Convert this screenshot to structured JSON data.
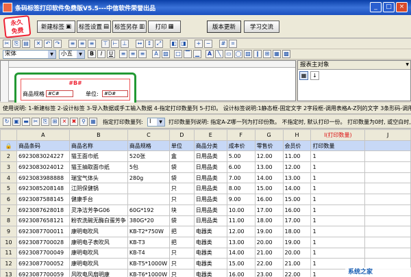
{
  "window": {
    "title": "条码标签打印软件免费版V5.5---中信软件荣誉出品"
  },
  "logo": {
    "line1": "永久",
    "line2": "免费"
  },
  "top_buttons": [
    {
      "label": "新建标签",
      "icon": "new-icon"
    },
    {
      "label": "标签设置",
      "icon": "settings-icon"
    },
    {
      "label": "标签另存",
      "icon": "saveas-icon"
    },
    {
      "label": "打印",
      "icon": "print-icon"
    },
    {
      "label": "版本更新",
      "icon": "update-icon"
    },
    {
      "label": "学习交流",
      "icon": "chat-icon"
    }
  ],
  "font_bar": {
    "font": "宋体",
    "size": "小五",
    "bold": "B",
    "italic": "I",
    "underline": "U"
  },
  "label_preview": {
    "barcode_field": "#B#",
    "field1_label": "商品规格",
    "field1_value": "#C#",
    "field2_label": "单位:",
    "field2_value": "#D#"
  },
  "props_panel": {
    "title": "报表主对象"
  },
  "instructions": "使用说明: 1-新建标签 2-设计标签 3-导入数据或手工输入数据 4-指定打印数量列 5-打印。 设计标签说明:1静态框-固定文字 2字段框-调用表格A-Z列的文字 3条形码-调用表格A-Z列的",
  "data_toolbar": {
    "print_qty_label": "指定打印数量列:",
    "print_qty_value": "I",
    "hint": "打印数量列说明: 指定A-Z哪一列为打印份数。 不指定时, 默认打印一份。 打印数量为0时, 或空白时, 不打印"
  },
  "grid": {
    "columns": [
      "A",
      "B",
      "C",
      "D",
      "E",
      "F",
      "G",
      "H",
      "I(打印数量)",
      "J"
    ],
    "header_row": [
      "商品条码",
      "商品名称",
      "商品规格",
      "单位",
      "商品分类",
      "成本价",
      "零售价",
      "会员价",
      "打印数量",
      ""
    ],
    "rows": [
      [
        "2",
        "6923083024227",
        "猫王面巾纸",
        "520张",
        "盒",
        "日用品类",
        "5.00",
        "12.00",
        "11.00",
        "1",
        ""
      ],
      [
        "3",
        "6923083024012",
        "猫王抽取面巾纸",
        "5包",
        "袋",
        "日用品类",
        "6.00",
        "13.00",
        "12.00",
        "1",
        ""
      ],
      [
        "4",
        "6923083988888",
        "瑞宝气体头",
        "280g",
        "袋",
        "日用品类",
        "7.00",
        "14.00",
        "13.00",
        "1",
        ""
      ],
      [
        "5",
        "6923085208148",
        "江阴保健锅",
        "",
        "只",
        "日用品类",
        "8.00",
        "15.00",
        "14.00",
        "1",
        ""
      ],
      [
        "6",
        "6923087588145",
        "健康手台",
        "",
        "只",
        "日用品类",
        "9.00",
        "16.00",
        "15.00",
        "1",
        ""
      ],
      [
        "7",
        "6923087628018",
        "灵净洁芳争G06",
        "60G*192",
        "块",
        "日用品类",
        "10.00",
        "17.00",
        "16.00",
        "1",
        ""
      ],
      [
        "8",
        "6923087658121",
        "粉农洗碗无酶白蛋芳争",
        "380G*20",
        "袋",
        "日用品类",
        "11.00",
        "18.00",
        "17.00",
        "1",
        ""
      ],
      [
        "9",
        "6923087700011",
        "康明电吹风",
        "KB-T2*750W",
        "把",
        "电器类",
        "12.00",
        "19.00",
        "18.00",
        "1",
        ""
      ],
      [
        "10",
        "6923087700028",
        "康明电子表吹风",
        "KB-T3",
        "把",
        "电器类",
        "13.00",
        "20.00",
        "19.00",
        "1",
        ""
      ],
      [
        "11",
        "6923087700049",
        "康明电吹风",
        "KB-T4",
        "只",
        "电器类",
        "14.00",
        "21.00",
        "20.00",
        "1",
        ""
      ],
      [
        "12",
        "6923087700052",
        "康明电吹风",
        "KB-T5*1000W",
        "只",
        "电器类",
        "15.00",
        "22.00",
        "21.00",
        "1",
        ""
      ],
      [
        "13",
        "6923087700059",
        "风吹电风扇明康",
        "KB-T6*1000W",
        "只",
        "电器类",
        "16.00",
        "23.00",
        "22.00",
        "1",
        ""
      ]
    ]
  },
  "watermark": "系统之家"
}
